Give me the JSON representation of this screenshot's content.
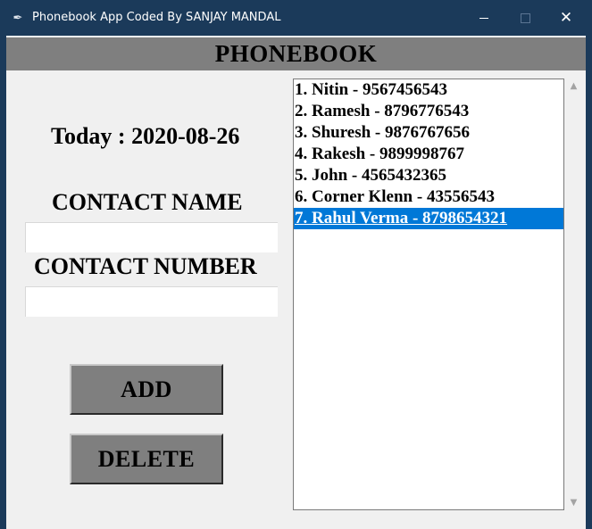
{
  "window": {
    "title": "Phonebook App Coded By SANJAY MANDAL",
    "icon": "feather-icon"
  },
  "header": {
    "title": "PHONEBOOK"
  },
  "form": {
    "today_label": "Today : 2020-08-26",
    "contact_name_label": "CONTACT NAME",
    "contact_name_value": "",
    "contact_number_label": "CONTACT NUMBER",
    "contact_number_value": "",
    "add_label": "ADD",
    "delete_label": "DELETE"
  },
  "contacts": [
    "1. Nitin - 9567456543",
    "2. Ramesh - 8796776543",
    "3. Shuresh - 9876767656",
    "4. Rakesh - 9899998767",
    "5. John - 4565432365",
    "6. Corner Klenn - 43556543",
    "7. Rahul Verma - 8798654321"
  ],
  "selected_index": 6,
  "colors": {
    "titlebar": "#1b3a5a",
    "header": "#7f7f7f",
    "button": "#7f7f7f",
    "selection": "#0078d7"
  }
}
